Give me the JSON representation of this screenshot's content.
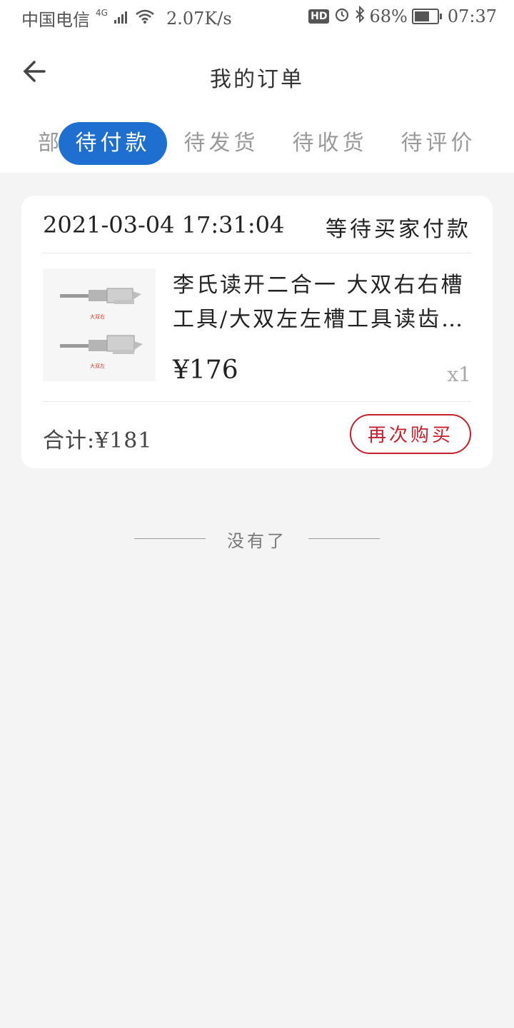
{
  "status_bar": {
    "carrier": "中国电信",
    "network": "4G",
    "speed": "2.07K/s",
    "hd": "HD",
    "battery": "68%",
    "battery_level": 0.68,
    "time": "07:37"
  },
  "header": {
    "title": "我的订单",
    "back_icon": "arrow-left-icon"
  },
  "tabs": [
    {
      "label": "全部",
      "visible": "部"
    },
    {
      "label": "待付款",
      "active": true
    },
    {
      "label": "待发货"
    },
    {
      "label": "待收货"
    },
    {
      "label": "待评价"
    }
  ],
  "order": {
    "time": "2021-03-04 17:31:04",
    "status": "等待买家付款",
    "product": {
      "name": "李氏读开二合一 大双右右槽工具/大双左左槽工具读齿开锁",
      "thumb_label_top": "大双右",
      "thumb_label_bottom": "大双左",
      "price": "¥176",
      "qty": "x1"
    },
    "total": "合计:¥181",
    "rebuy_label": "再次购买"
  },
  "list_end": "没有了",
  "colors": {
    "accent_blue": "#1f6fd1",
    "rebuy_red": "#c8202a",
    "background": "#f4f4f4"
  }
}
